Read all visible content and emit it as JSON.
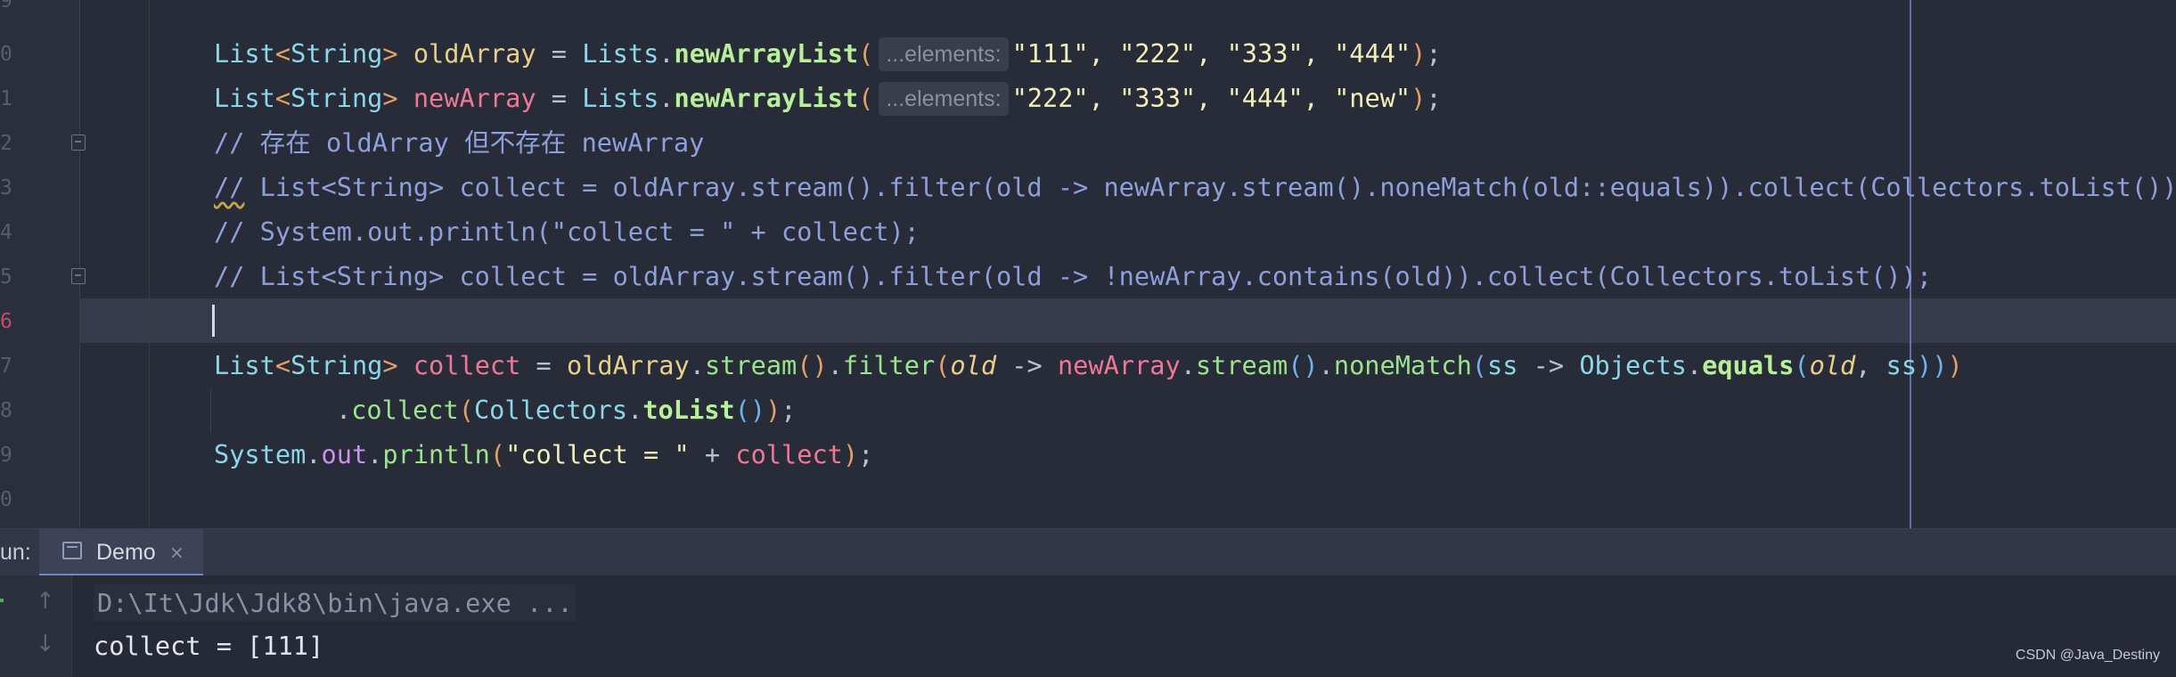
{
  "editor": {
    "line_numbers": [
      "9",
      "0",
      "1",
      "2",
      "3",
      "4",
      "5",
      "6",
      "7",
      "8",
      "9",
      "0"
    ],
    "active_line_index": 7,
    "hints": {
      "elements": "...elements:"
    },
    "lines": {
      "l1": {
        "type": "List",
        "lt": "<",
        "typeArg": "String",
        "gt": ">",
        "var": "oldArray",
        "eq": " = ",
        "cls": "Lists",
        "dot": ".",
        "method": "newArrayList",
        "lp": "(",
        "args": "\"111\", \"222\", \"333\", \"444\"",
        "rp": ")",
        "semi": ";"
      },
      "l2": {
        "type": "List",
        "lt": "<",
        "typeArg": "String",
        "gt": ">",
        "var": "newArray",
        "eq": " = ",
        "cls": "Lists",
        "dot": ".",
        "method": "newArrayList",
        "lp": "(",
        "args": "\"222\", \"333\", \"444\", \"new\"",
        "rp": ")",
        "semi": ";"
      },
      "l3": "// 存在 oldArray 但不存在 newArray",
      "l4_slashes": "//",
      "l4_rest": " List<String> collect = oldArray.stream().filter(old -> newArray.stream().noneMatch(old::equals)).collect(Collectors.toList());",
      "l5": "// System.out.println(\"collect = \" + collect);",
      "l6": "// List<String> collect = oldArray.stream().filter(old -> !newArray.contains(old)).collect(Collectors.toList());",
      "l8": {
        "type": "List",
        "lt": "<",
        "typeArg": "String",
        "gt": ">",
        "var": "collect",
        "eq": " = ",
        "obj": "oldArray",
        "dot1": ".",
        "stream": "stream",
        "p1": "()",
        "dot2": ".",
        "filter": "filter",
        "p2o": "(",
        "lam": "old",
        "arrow": " -> ",
        "obj2": "newArray",
        "dot3": ".",
        "stream2": "stream",
        "p3": "()",
        "dot4": ".",
        "none": "noneMatch",
        "p4o": "(",
        "param": "ss",
        "arrow2": " -> ",
        "objs": "Objects",
        "dot5": ".",
        "eqm": "equals",
        "p5o": "(",
        "arg1": "old",
        "comma": ", ",
        "arg2": "ss",
        "p5c": ")",
        "p4c": ")",
        "p2c": ")"
      },
      "l9": {
        "dot": ".",
        "collect": "collect",
        "p1o": "(",
        "cls": "Collectors",
        "dot2": ".",
        "toList": "toList",
        "p2": "()",
        "p1c": ")",
        "semi": ";"
      },
      "l10": {
        "sys": "System",
        "dot": ".",
        "out": "out",
        "dot2": ".",
        "println": "println",
        "po": "(",
        "str": "\"collect = \"",
        "plus": " + ",
        "var": "collect",
        "pc": ")",
        "semi": ";"
      }
    }
  },
  "run_panel": {
    "label": "un:",
    "tab_label": "Demo",
    "close_glyph": "×",
    "up_glyph": "↑",
    "down_glyph": "↓",
    "command": "D:\\It\\Jdk\\Jdk8\\bin\\java.exe ...",
    "output": "collect = [111]"
  },
  "watermark": "CSDN @Java_Destiny"
}
